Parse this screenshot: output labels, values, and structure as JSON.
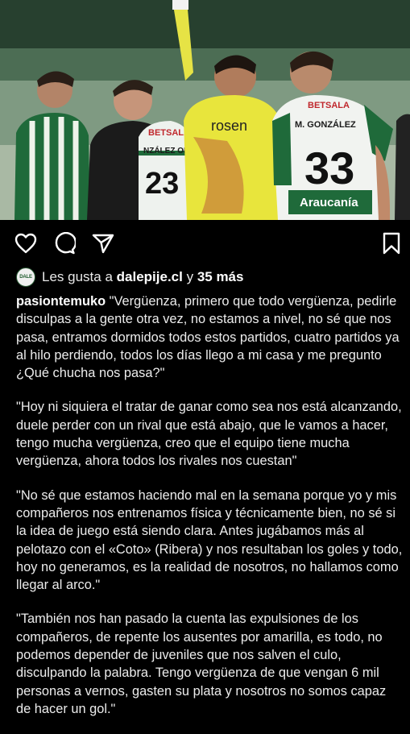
{
  "post": {
    "photo_alt": "Jugadores del club en el campo",
    "photo_texts": {
      "sponsor_left": "BETSALA",
      "name_left": "NZÁLEZ ONI",
      "number_left": "23",
      "keeper_sponsor": "rosen",
      "sponsor_right": "BETSALA",
      "name_right": "M. GONZÁLEZ",
      "number_right": "33",
      "sponsor_right_bottom": "Araucanía"
    },
    "actions": {
      "like": "heart-icon",
      "comment": "comment-icon",
      "share": "send-icon",
      "save": "bookmark-icon"
    },
    "likes": {
      "avatar_text": "DALE",
      "prefix": "Les gusta a",
      "user": "dalepije.cl",
      "connector": "y",
      "others": "35 más"
    },
    "caption": {
      "username": "pasiontemuko",
      "p1": "\"Vergüenza, primero que todo vergüenza, pedirle disculpas a la gente otra vez, no estamos a nivel, no sé que nos pasa, entramos dormidos todos estos partidos, cuatro partidos ya al hilo perdiendo, todos los días llego a mi casa y me pregunto ¿Qué chucha nos pasa?\"",
      "p2": "\"Hoy ni siquiera el tratar de ganar como sea nos está alcanzando, duele perder con un rival que está abajo, que le vamos a hacer, tengo mucha vergüenza, creo que el equipo tiene mucha vergüenza, ahora todos los rivales nos cuestan\"",
      "p3": "\"No sé que estamos haciendo mal en la semana porque yo y mis compañeros nos entrenamos física y técnicamente bien, no sé si la idea de juego está siendo clara. Antes jugábamos más al pelotazo con el «Coto» (Ribera) y nos resultaban los goles y todo, hoy no generamos, es la realidad de nosotros, no hallamos como llegar al arco.\"",
      "p4": "\"También nos han pasado la cuenta las expulsiones de los compañeros, de repente los ausentes por amarilla, es todo, no podemos depender de juveniles que nos salven el culo, disculpando la palabra. Tengo vergüenza de que vengan 6 mil personas a vernos, gasten su plata y nosotros no somos capaz de hacer un gol.\""
    }
  }
}
